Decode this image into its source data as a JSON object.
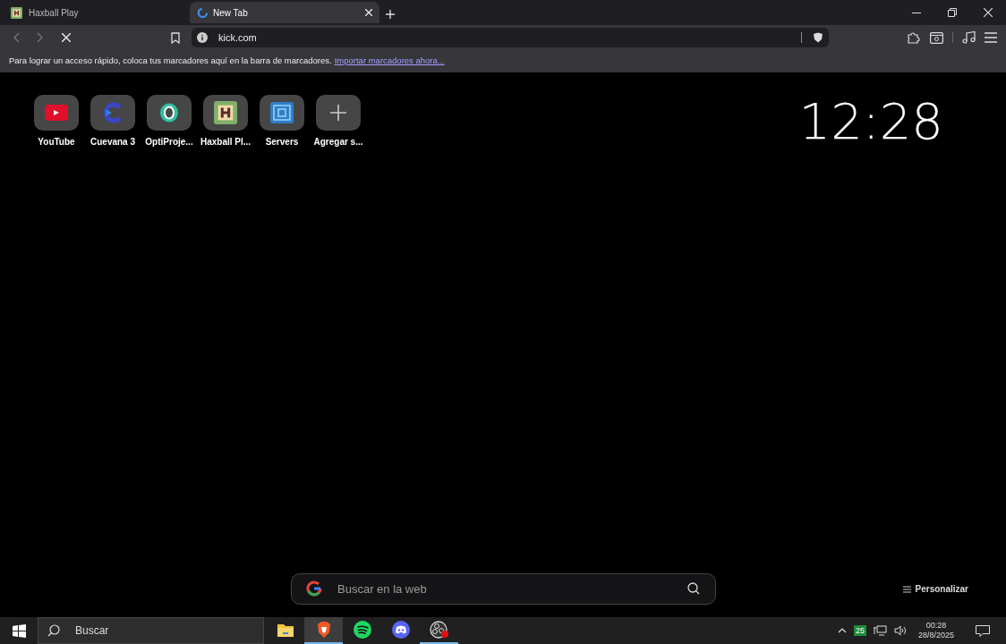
{
  "tabs": [
    {
      "title": "Haxball Play",
      "kind": "haxball",
      "selected": false
    },
    {
      "title": "New Tab",
      "kind": "loading",
      "selected": true
    }
  ],
  "toolbar": {
    "url": "kick.com"
  },
  "bookmarks_bar": {
    "message": "Para lograr un acceso rápido, coloca tus marcadores aquí en la barra de marcadores.",
    "link": "Importar marcadores ahora..."
  },
  "shortcuts": [
    {
      "label": "YouTube",
      "kind": "youtube"
    },
    {
      "label": "Cuevana 3",
      "kind": "cuevana"
    },
    {
      "label": "OptiProje...",
      "kind": "opti"
    },
    {
      "label": "Haxball Pl...",
      "kind": "haxball"
    },
    {
      "label": "Servers",
      "kind": "servers"
    },
    {
      "label": "Agregar s...",
      "kind": "add"
    }
  ],
  "clock": "12:28",
  "search": {
    "placeholder": "Buscar en la web"
  },
  "customize": "Personalizar",
  "taskbar": {
    "search_placeholder": "Buscar",
    "apps": [
      {
        "kind": "files",
        "selected": false,
        "running": false
      },
      {
        "kind": "brave",
        "selected": true,
        "running": true
      },
      {
        "kind": "spotify",
        "selected": false,
        "running": false
      },
      {
        "kind": "discord",
        "selected": false,
        "running": false
      },
      {
        "kind": "obs",
        "selected": false,
        "running": true
      }
    ],
    "tray_badge": "25",
    "time": "00:28",
    "date": "28/8/2025"
  }
}
